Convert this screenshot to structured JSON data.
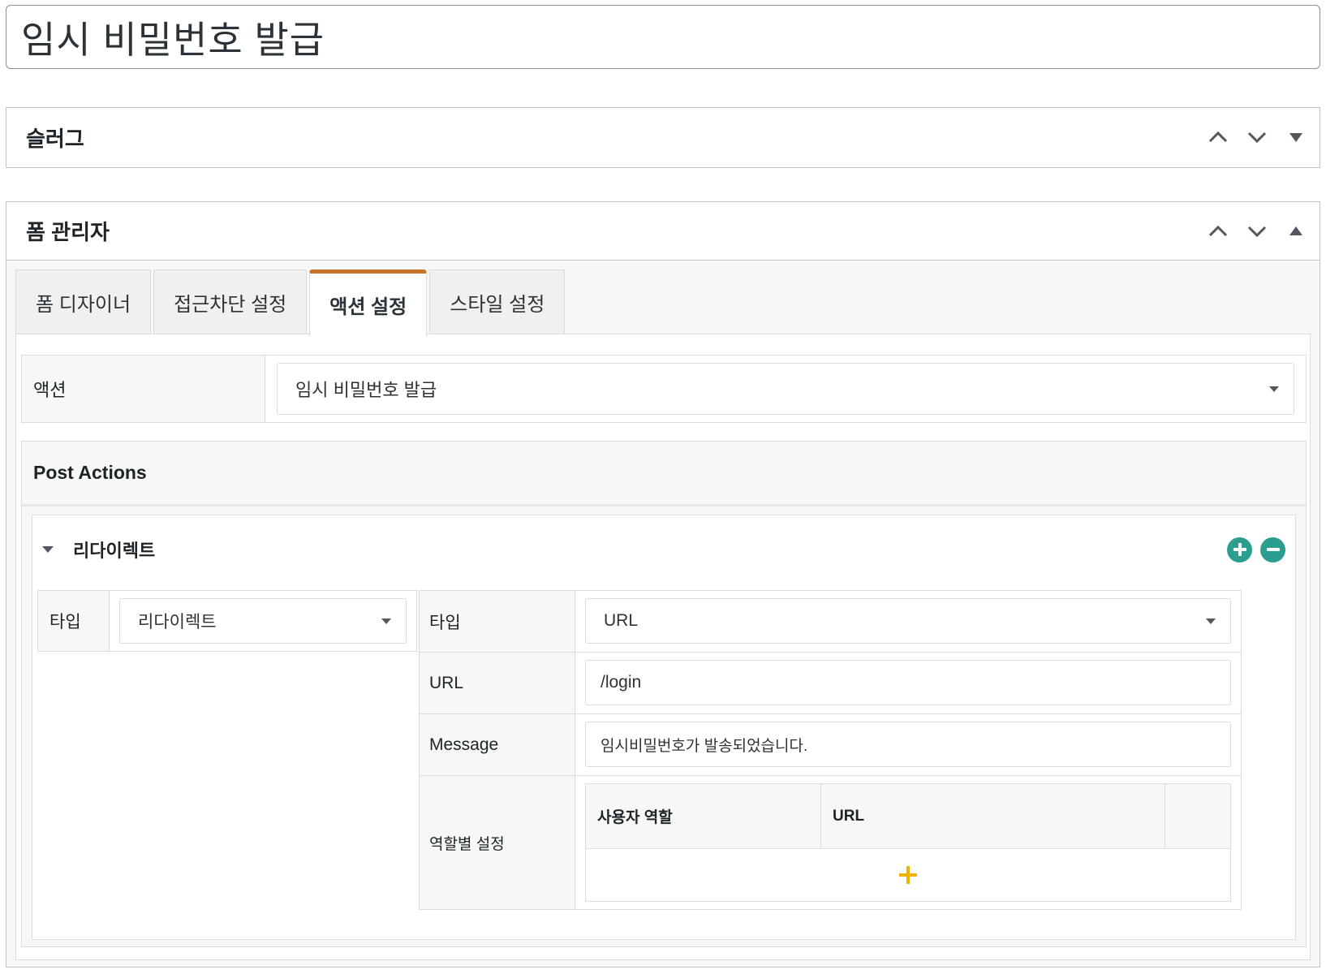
{
  "page": {
    "title": "임시 비밀번호 발급"
  },
  "slug_box": {
    "title": "슬러그"
  },
  "form_manager": {
    "title": "폼 관리자",
    "tabs": [
      {
        "label": "폼 디자이너"
      },
      {
        "label": "접근차단 설정"
      },
      {
        "label": "액션 설정"
      },
      {
        "label": "스타일 설정"
      }
    ],
    "active_tab": "액션 설정",
    "action": {
      "label": "액션",
      "value": "임시 비밀번호 발급"
    },
    "post_actions": {
      "title": "Post Actions",
      "item": {
        "title": "리다이렉트",
        "type_label": "타입",
        "type_value": "리다이렉트",
        "settings": {
          "type_label": "타입",
          "type_value": "URL",
          "url_label": "URL",
          "url_value": "/login",
          "message_label": "Message",
          "message_value": "임시비밀번호가 발송되었습니다.",
          "role_label": "역할별 설정",
          "role_table": {
            "col_role": "사용자 역할",
            "col_url": "URL"
          }
        }
      }
    }
  },
  "colors": {
    "active_tab_accent": "#c8722a",
    "round_button": "#2b9e8f",
    "add_row_plus": "#f0b400"
  },
  "icons": {
    "move_up": "chevron-up-icon",
    "move_down": "chevron-down-icon",
    "toggle": "triangle-icon",
    "add": "plus-circle-icon",
    "remove": "minus-circle-icon",
    "add_row": "plus-icon"
  }
}
